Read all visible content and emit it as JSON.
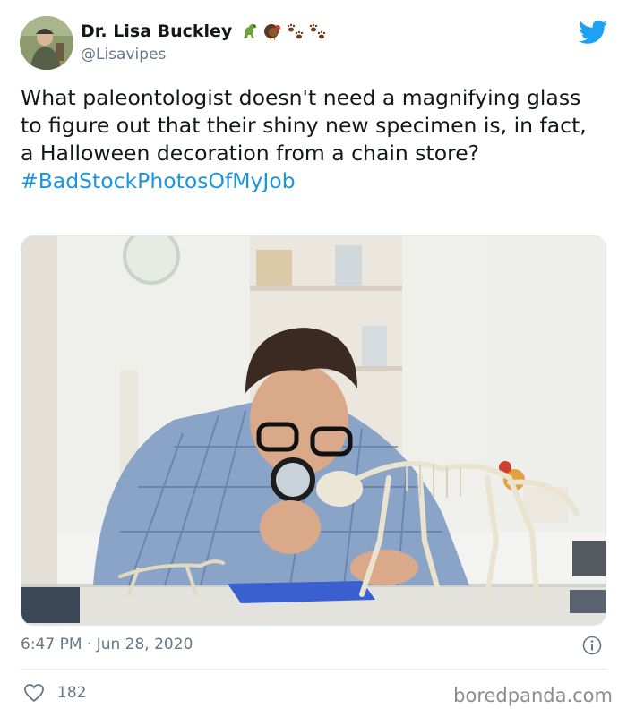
{
  "tweet": {
    "author": {
      "display_name": "Dr. Lisa Buckley",
      "handle": "@Lisavipes"
    },
    "name_emojis": [
      "dinosaur-emoji",
      "turkey-emoji",
      "paw-prints-emoji",
      "paw-prints-emoji"
    ],
    "text": "What paleontologist doesn't need a magnifying glass to figure out that their shiny new specimen is, in fact, a Halloween decoration from a chain store?",
    "hashtag": "#BadStockPhotosOfMyJob",
    "timestamp": "6:47 PM · Jun 28, 2020",
    "likes": "182",
    "colors": {
      "link": "#1b95e0",
      "twitter_blue": "#1da1f2",
      "muted": "#657786"
    }
  },
  "watermark": "boredpanda.com"
}
